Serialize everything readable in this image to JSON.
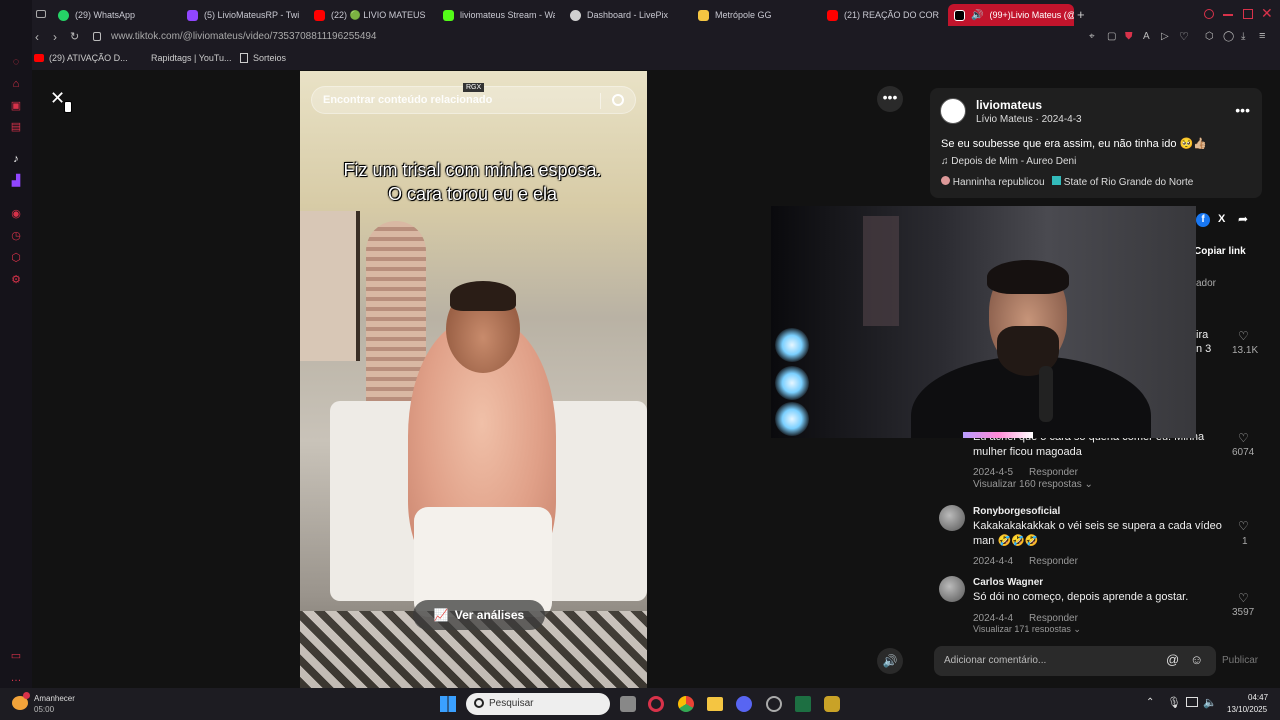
{
  "tabs": [
    {
      "label": "(29) WhatsApp",
      "color": "#25d366"
    },
    {
      "label": "(5) LivioMateusRP - Twitc",
      "color": "#9146ff"
    },
    {
      "label": "(22) 🟢 LIVIO MATEUS",
      "color": "#ff0000"
    },
    {
      "label": "liviomateus Stream - Wat",
      "color": "#53fc18"
    },
    {
      "label": "Dashboard - LivePix",
      "color": "#d0d0d0"
    },
    {
      "label": "Metrópole GG",
      "color": "#f4c542"
    },
    {
      "label": "(21) REAÇÃO DO CORONI",
      "color": "#ff0000"
    },
    {
      "label": "(99+)Livio Mateus (@",
      "color": "#000000"
    }
  ],
  "address": {
    "url": "www.tiktok.com/@liviomateus/video/7353708811196255494"
  },
  "bookmarks": [
    {
      "label": "(29) ATIVAÇÃO D..."
    },
    {
      "label": "Rapidtags | YouTu..."
    },
    {
      "label": "Sorteios"
    }
  ],
  "video": {
    "search_placeholder": "Encontrar conteúdo relacionado",
    "watermark": "RGX",
    "caption": "Fiz um trisal com minha esposa. O cara torou eu e ela",
    "analytics_label": "Ver análises"
  },
  "post": {
    "username": "liviomateus",
    "display_name": "Lívio Mateus",
    "date": "2024-4-3",
    "description": "Se eu soubesse que era assim, eu não tinha ido 🥺👍🏼",
    "music": "Depois de Mim - Aureo Deni",
    "reposted_by": "Hanninha republicou",
    "location": "State of Rio Grande do Norte",
    "copy_link": "Copiar link",
    "creator_partial": "ador"
  },
  "comments": [
    {
      "text_partial": "ira\nn 3",
      "likes": "13.1K"
    },
    {
      "author": "",
      "text": "Eu achei que o cara só queria comer eu. Minha mulher ficou magoada",
      "date": "2024-4-5",
      "reply": "Responder",
      "likes": "6074",
      "view_replies": "Visualizar 160 respostas"
    },
    {
      "author": "Ronyborgesoficial",
      "text": "Kakakakakakkak o véi seis se supera a cada vídeo man 🤣🤣🤣",
      "date": "2024-4-4",
      "reply": "Responder",
      "likes": "1"
    },
    {
      "author": "Carlos Wagner",
      "text": "Só dói no começo, depois aprende a gostar.",
      "date": "2024-4-4",
      "reply": "Responder",
      "likes": "3597",
      "view_replies": "Visualizar 171 respostas"
    }
  ],
  "comment_input": {
    "placeholder": "Adicionar comentário...",
    "publish": "Publicar"
  },
  "taskbar": {
    "weather_label": "Amanhecer",
    "weather_time": "05:00",
    "search_placeholder": "Pesquisar",
    "time": "04:47",
    "date": "13/10/2025"
  }
}
